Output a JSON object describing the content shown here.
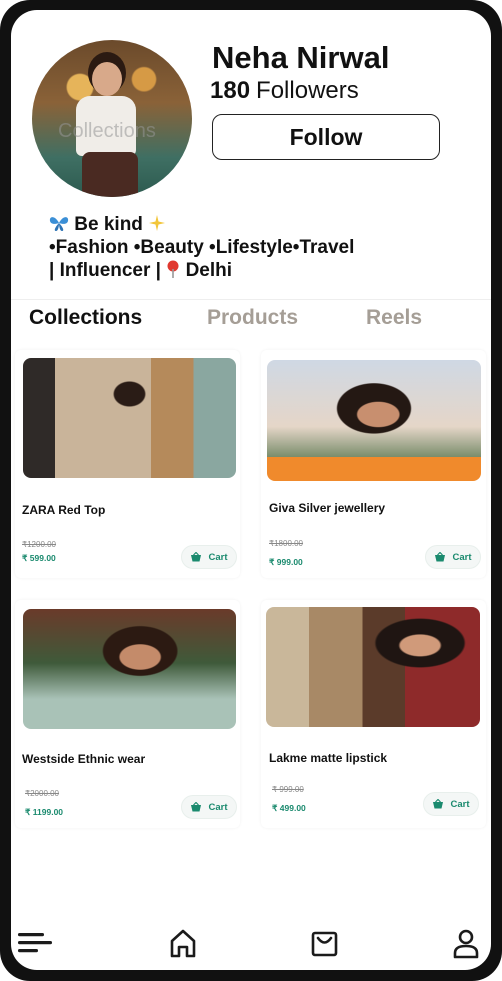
{
  "profile": {
    "name": "Neha Nirwal",
    "followers_count": "180",
    "followers_label": "Followers",
    "follow_button": "Follow",
    "avatar_overlay_text": "Collections"
  },
  "bio": {
    "line1_text": "Be kind",
    "line2": "•Fashion •Beauty •Lifestyle•Travel",
    "line3_prefix": "| Influencer |",
    "line3_location": "Delhi"
  },
  "tabs": [
    {
      "label": "Collections",
      "active": true
    },
    {
      "label": "Products",
      "active": false
    },
    {
      "label": "Reels",
      "active": false
    }
  ],
  "products": [
    {
      "name": "ZARA Red Top",
      "old_price": "₹1200.00",
      "new_price": "₹ 599.00",
      "cart_label": "Cart"
    },
    {
      "name": "Giva Silver jewellery",
      "old_price": "₹1800.00",
      "new_price": "₹ 999.00",
      "cart_label": "Cart"
    },
    {
      "name": "Westside Ethnic wear",
      "old_price": "₹2000.00",
      "new_price": "₹ 1199.00",
      "cart_label": "Cart"
    },
    {
      "name": "Lakme matte lipstick",
      "old_price": "₹ 999.00",
      "new_price": "₹ 499.00",
      "cart_label": "Cart"
    }
  ],
  "colors": {
    "accent_green": "#1a8a6e",
    "inactive_tab": "#a59e96",
    "frame": "#111111"
  },
  "nav": {
    "icons": [
      "menu-icon",
      "home-icon",
      "shopping-bag-icon",
      "profile-icon"
    ]
  }
}
